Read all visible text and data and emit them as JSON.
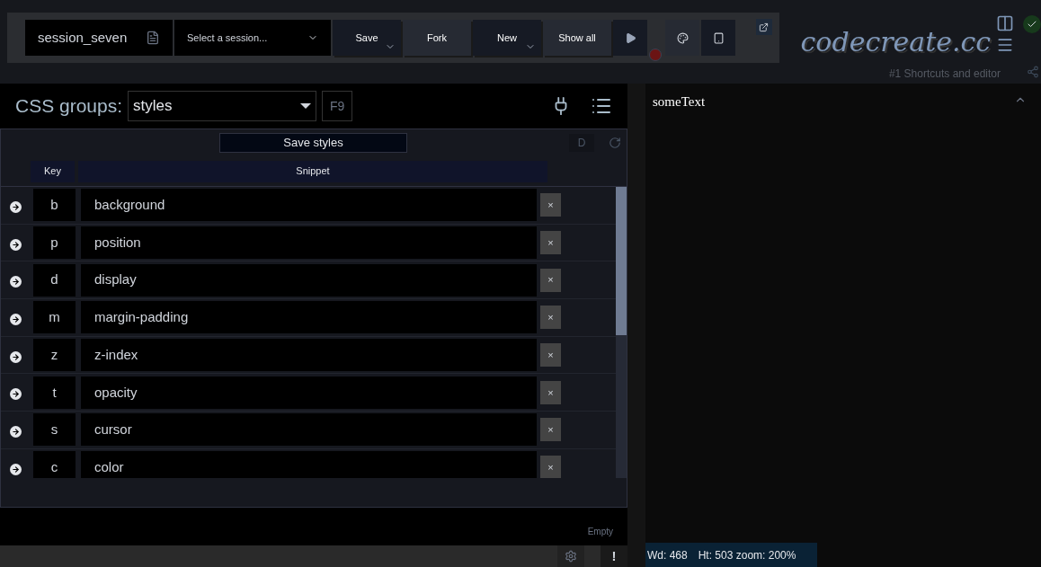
{
  "toolbar": {
    "session_name": "session_seven",
    "session_select": {
      "placeholder": "Select a session..."
    },
    "buttons": [
      {
        "label": "Save",
        "kind": "dropdown"
      },
      {
        "label": "Fork",
        "kind": "plain"
      },
      {
        "label": "New",
        "kind": "dropdown"
      },
      {
        "label": "Show all",
        "kind": "plain"
      }
    ]
  },
  "logo": "codecreate.cc",
  "status_ok": true,
  "subtitle": "#1 Shortcuts and editor",
  "css_groups": {
    "label": "CSS groups:",
    "value": "styles",
    "shortcut": "F9"
  },
  "save_styles": "Save styles",
  "d_button": "D",
  "table": {
    "columns": [
      "Key",
      "Snippet"
    ],
    "rows": [
      {
        "key": "b",
        "snippet": "background",
        "remove": "×"
      },
      {
        "key": "p",
        "snippet": "position",
        "remove": "×"
      },
      {
        "key": "d",
        "snippet": "display",
        "remove": "×"
      },
      {
        "key": "m",
        "snippet": "margin-padding",
        "remove": "×"
      },
      {
        "key": "z",
        "snippet": "z-index",
        "remove": "×"
      },
      {
        "key": "t",
        "snippet": "opacity",
        "remove": "×"
      },
      {
        "key": "s",
        "snippet": "cursor",
        "remove": "×"
      },
      {
        "key": "c",
        "snippet": "color",
        "remove": "×"
      }
    ]
  },
  "empty_label": "Empty",
  "footer_alert": "!",
  "preview": {
    "text": "someText",
    "status": {
      "width": "Wd: 468",
      "height": "Ht: 503 zoom: 200%"
    }
  }
}
